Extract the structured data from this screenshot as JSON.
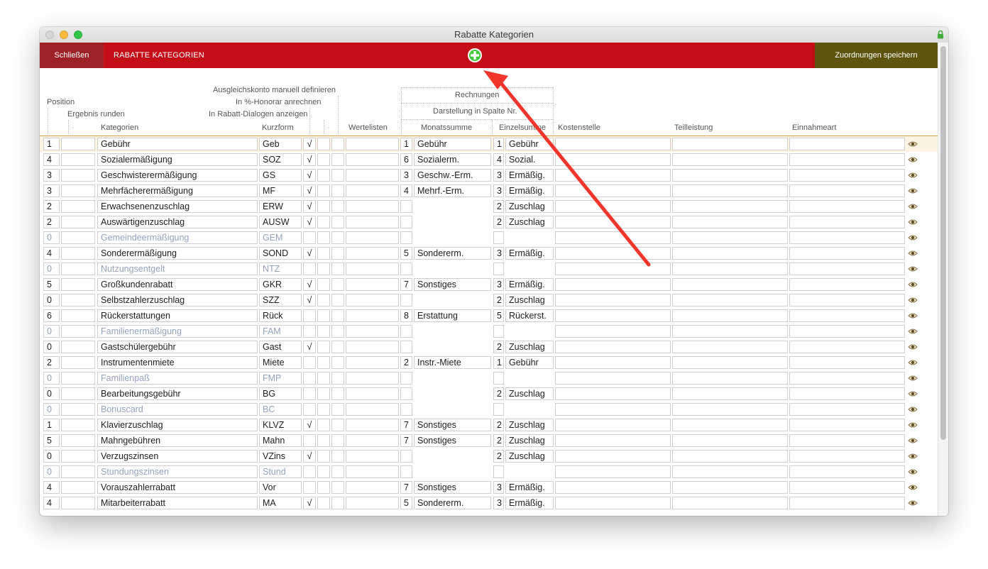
{
  "window": {
    "title": "Rabatte Kategorien"
  },
  "toolbar": {
    "close_label": "Schließen",
    "title": "RABATTE KATEGORIEN",
    "save_label": "Zuordnungen speichern"
  },
  "headers": {
    "position": "Position",
    "ergebnis_runden": "Ergebnis runden",
    "kategorien": "Kategorien",
    "ausgleichskonto": "Ausgleichskonto manuell definieren",
    "honorar": "In %-Honorar anrechnen",
    "rabatt_dialogen": "In Rabatt-Dialogen anzeigen",
    "kurzform": "Kurzform",
    "wertelisten": "Wertelisten",
    "rechnungen": "Rechnungen",
    "darstellung": "Darstellung in Spalte Nr.",
    "monatssumme": "Monatssumme",
    "einzelsumme": "Einzelsumme",
    "kostenstelle": "Kostenstelle",
    "teilleistung": "Teilleistung",
    "einnahmeart": "Einnahmeart"
  },
  "rows": [
    {
      "pos": "1",
      "name": "Gebühr",
      "kurz": "Geb",
      "check": "√",
      "mnum": "1",
      "mtext": "Gebühr",
      "enum": "1",
      "etext": "Gebühr",
      "active": true
    },
    {
      "pos": "4",
      "name": "Sozialermäßigung",
      "kurz": "SOZ",
      "check": "√",
      "mnum": "6",
      "mtext": "Sozialerm.",
      "enum": "4",
      "etext": "Sozial.",
      "active": true
    },
    {
      "pos": "3",
      "name": "Geschwisterermäßigung",
      "kurz": "GS",
      "check": "√",
      "mnum": "3",
      "mtext": "Geschw.-Erm.",
      "enum": "3",
      "etext": "Ermäßig.",
      "active": true
    },
    {
      "pos": "3",
      "name": "Mehrfächerermäßigung",
      "kurz": "MF",
      "check": "√",
      "mnum": "4",
      "mtext": "Mehrf.-Erm.",
      "enum": "3",
      "etext": "Ermäßig.",
      "active": true
    },
    {
      "pos": "2",
      "name": "Erwachsenenzuschlag",
      "kurz": "ERW",
      "check": "√",
      "mnum": "",
      "mtext": "",
      "enum": "2",
      "etext": "Zuschlag",
      "active": true
    },
    {
      "pos": "2",
      "name": "Auswärtigenzuschlag",
      "kurz": "AUSW",
      "check": "√",
      "mnum": "",
      "mtext": "",
      "enum": "2",
      "etext": "Zuschlag",
      "active": true
    },
    {
      "pos": "0",
      "name": "Gemeindeermäßigung",
      "kurz": "GEM",
      "check": "",
      "mnum": "",
      "mtext": "",
      "enum": "",
      "etext": "",
      "active": false
    },
    {
      "pos": "4",
      "name": "Sonderermäßigung",
      "kurz": "SOND",
      "check": "√",
      "mnum": "5",
      "mtext": "Sondererm.",
      "enum": "3",
      "etext": "Ermäßig.",
      "active": true
    },
    {
      "pos": "0",
      "name": "Nutzungsentgelt",
      "kurz": "NTZ",
      "check": "",
      "mnum": "",
      "mtext": "",
      "enum": "",
      "etext": "",
      "active": false
    },
    {
      "pos": "5",
      "name": "Großkundenrabatt",
      "kurz": "GKR",
      "check": "√",
      "mnum": "7",
      "mtext": "Sonstiges",
      "enum": "3",
      "etext": "Ermäßig.",
      "active": true
    },
    {
      "pos": "0",
      "name": "Selbstzahlerzuschlag",
      "kurz": "SZZ",
      "check": "√",
      "mnum": "",
      "mtext": "",
      "enum": "2",
      "etext": "Zuschlag",
      "active": true
    },
    {
      "pos": "6",
      "name": "Rückerstattungen",
      "kurz": "Rück",
      "check": "",
      "mnum": "8",
      "mtext": "Erstattung",
      "enum": "5",
      "etext": "Rückerst.",
      "active": true
    },
    {
      "pos": "0",
      "name": "Familienermäßigung",
      "kurz": "FAM",
      "check": "",
      "mnum": "",
      "mtext": "",
      "enum": "",
      "etext": "",
      "active": false
    },
    {
      "pos": "0",
      "name": "Gastschülergebühr",
      "kurz": "Gast",
      "check": "√",
      "mnum": "",
      "mtext": "",
      "enum": "2",
      "etext": "Zuschlag",
      "active": true
    },
    {
      "pos": "2",
      "name": "Instrumentenmiete",
      "kurz": "Miete",
      "check": "",
      "mnum": "2",
      "mtext": "Instr.-Miete",
      "enum": "1",
      "etext": "Gebühr",
      "active": true
    },
    {
      "pos": "0",
      "name": "Familienpaß",
      "kurz": "FMP",
      "check": "",
      "mnum": "",
      "mtext": "",
      "enum": "",
      "etext": "",
      "active": false
    },
    {
      "pos": "0",
      "name": "Bearbeitungsgebühr",
      "kurz": "BG",
      "check": "",
      "mnum": "",
      "mtext": "",
      "enum": "2",
      "etext": "Zuschlag",
      "active": true
    },
    {
      "pos": "0",
      "name": "Bonuscard",
      "kurz": "BC",
      "check": "",
      "mnum": "",
      "mtext": "",
      "enum": "",
      "etext": "",
      "active": false
    },
    {
      "pos": "1",
      "name": "Klavierzuschlag",
      "kurz": "KLVZ",
      "check": "√",
      "mnum": "7",
      "mtext": "Sonstiges",
      "enum": "2",
      "etext": "Zuschlag",
      "active": true
    },
    {
      "pos": "5",
      "name": "Mahngebühren",
      "kurz": "Mahn",
      "check": "",
      "mnum": "7",
      "mtext": "Sonstiges",
      "enum": "2",
      "etext": "Zuschlag",
      "active": true
    },
    {
      "pos": "0",
      "name": "Verzugszinsen",
      "kurz": "VZins",
      "check": "√",
      "mnum": "",
      "mtext": "",
      "enum": "2",
      "etext": "Zuschlag",
      "active": true
    },
    {
      "pos": "0",
      "name": "Stundungszinsen",
      "kurz": "Stund",
      "check": "",
      "mnum": "",
      "mtext": "",
      "enum": "",
      "etext": "",
      "active": false
    },
    {
      "pos": "4",
      "name": "Vorauszahlerrabatt",
      "kurz": "Vor",
      "check": "",
      "mnum": "7",
      "mtext": "Sonstiges",
      "enum": "3",
      "etext": "Ermäßig.",
      "active": true
    },
    {
      "pos": "4",
      "name": "Mitarbeiterrabatt",
      "kurz": "MA",
      "check": "√",
      "mnum": "5",
      "mtext": "Sondererm.",
      "enum": "3",
      "etext": "Ermäßig.",
      "active": true
    }
  ],
  "colors": {
    "toolbar_red": "#c30d17",
    "close_button": "#9e2128",
    "save_button": "#5d5510",
    "add_icon_green": "#3fc73a",
    "annotation_arrow": "#f0362c",
    "inactive_text": "#93a3bc"
  }
}
